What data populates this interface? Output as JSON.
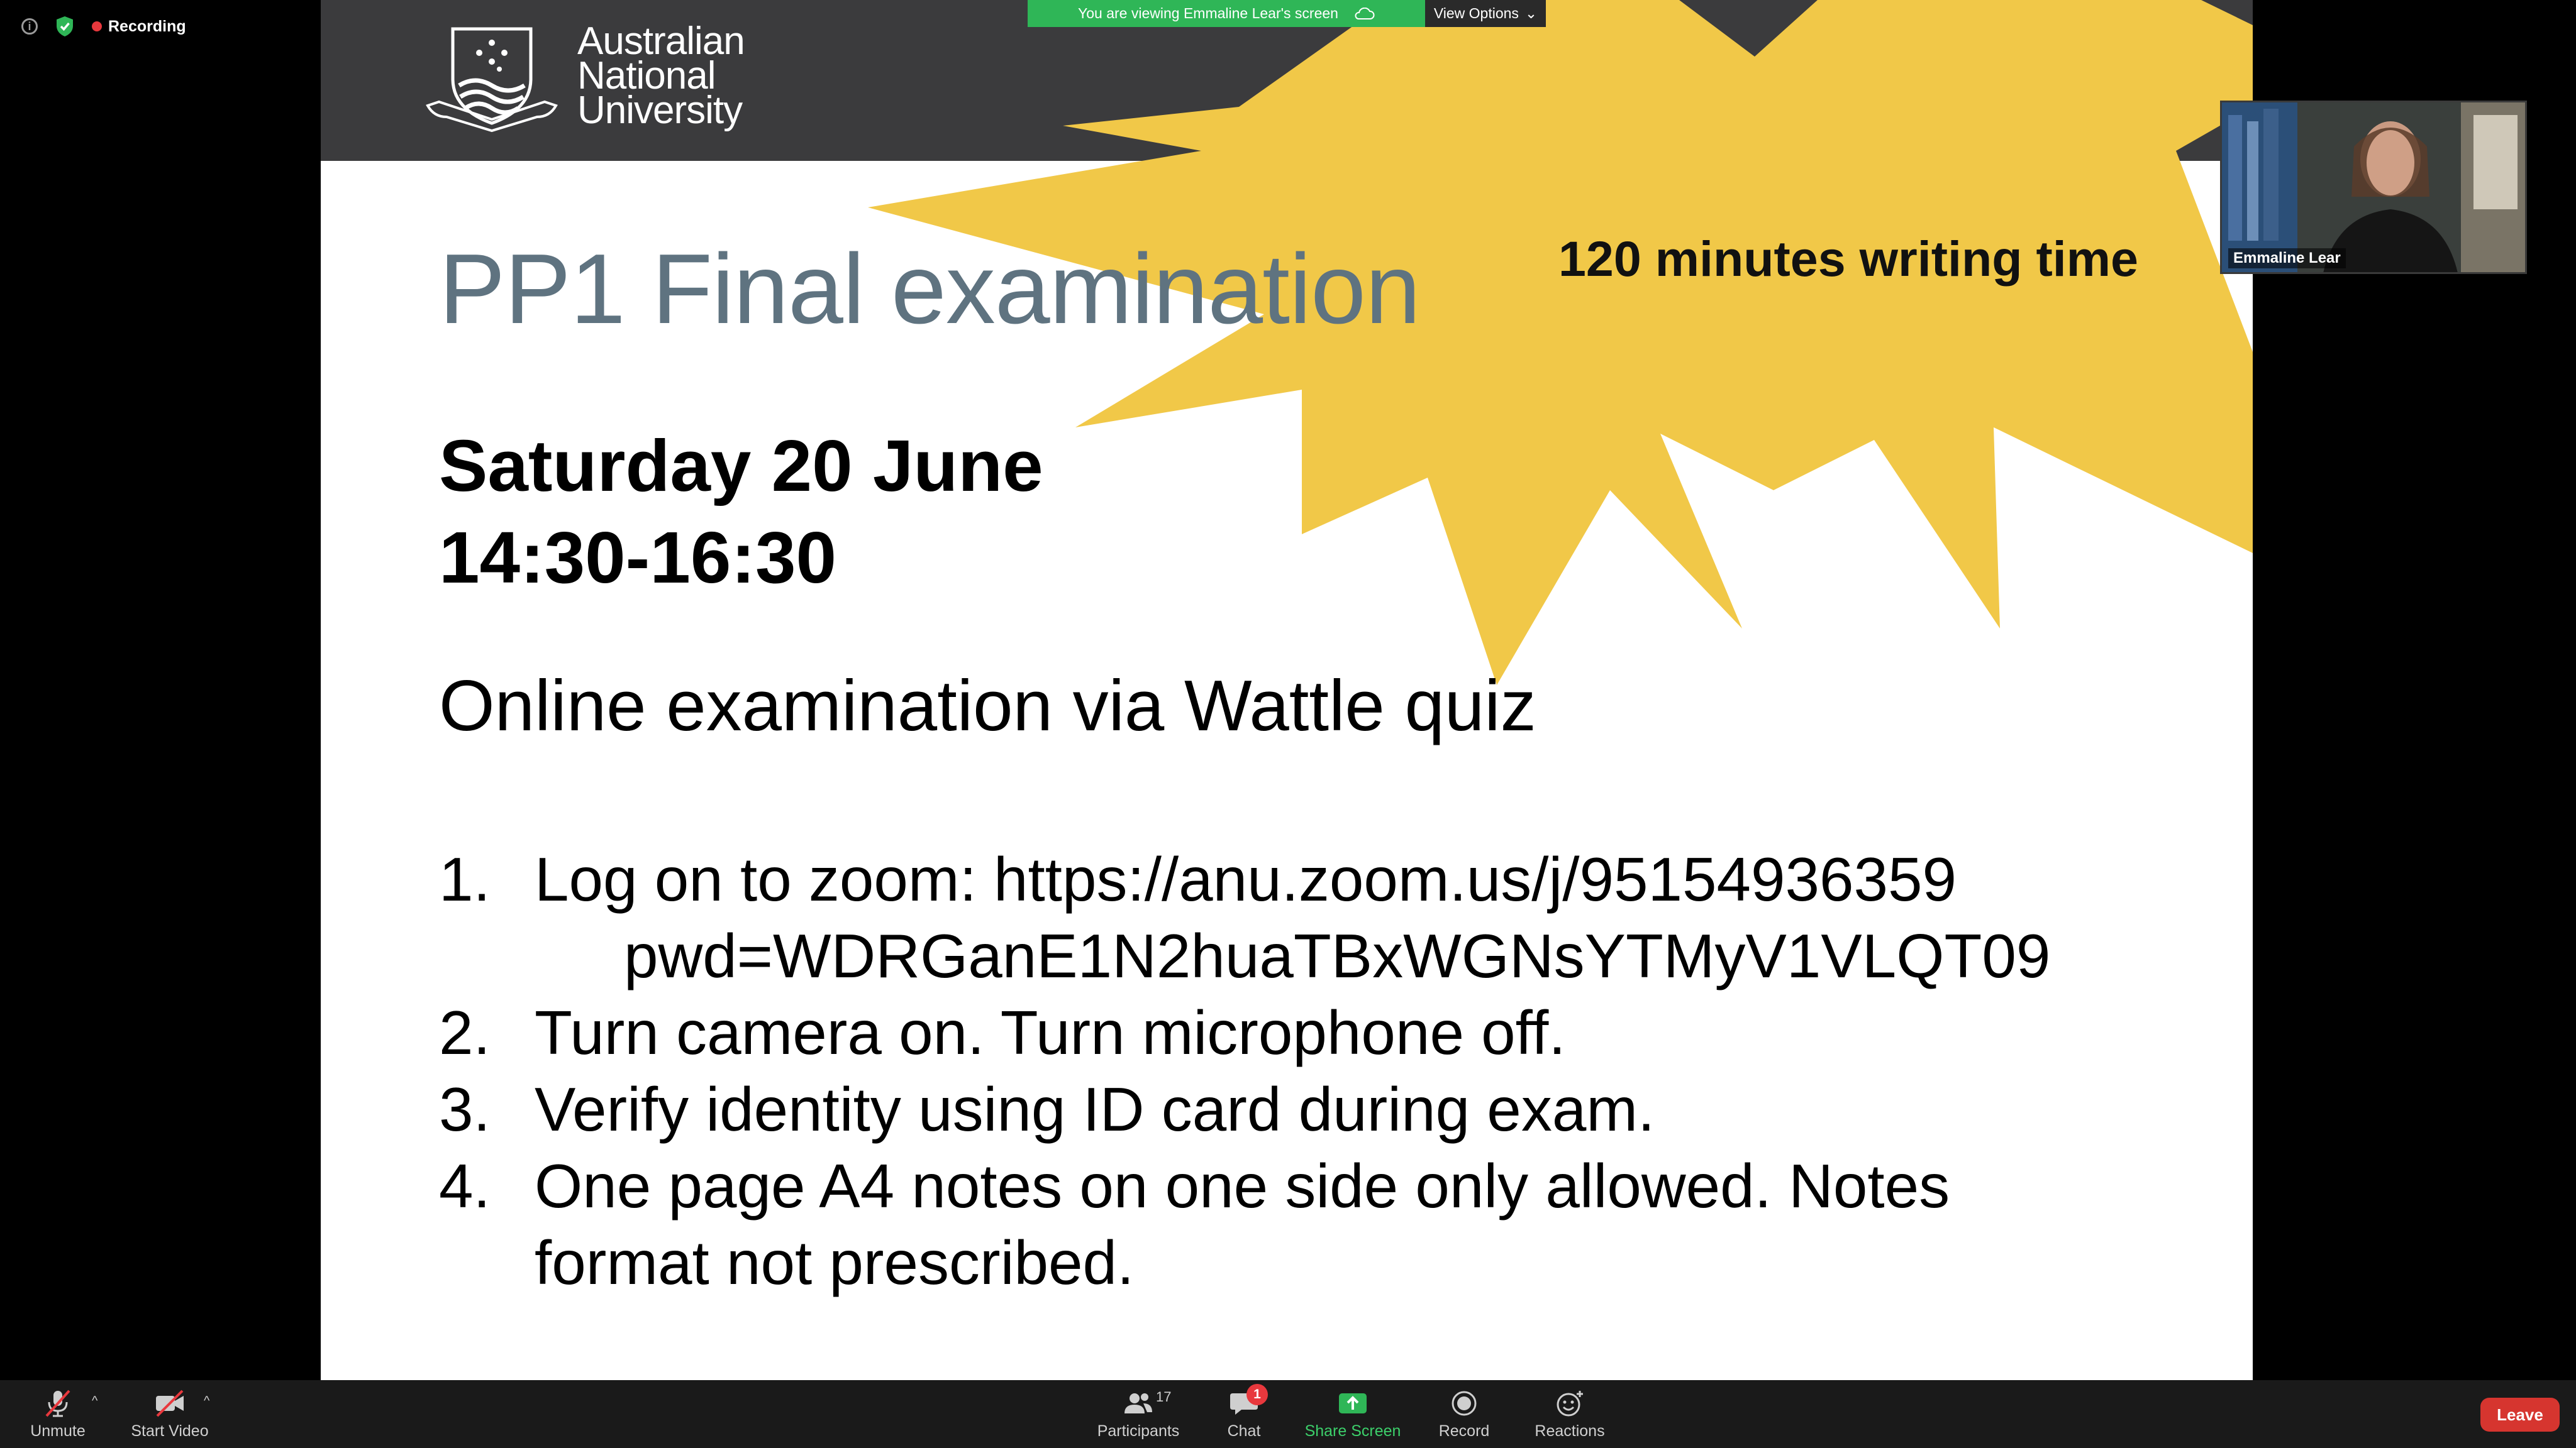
{
  "meeting": {
    "recording_label": "Recording"
  },
  "share_banner": {
    "text": "You are viewing Emmaline Lear's screen",
    "view_options_label": "View Options"
  },
  "slide": {
    "logo_lines": [
      "Australian",
      "National",
      "University"
    ],
    "starburst_text": "120 minutes writing time",
    "title": "PP1 Final examination",
    "date_line": "Saturday 20 June",
    "time_line": "14:30-16:30",
    "online_line": "Online examination via Wattle quiz",
    "steps": [
      {
        "num": "1.",
        "lines": [
          "Log on to zoom: https://anu.zoom.us/j/95154936359",
          "pwd=WDRGanE1N2huaTBxWGNsYTMyV1VLQT09"
        ]
      },
      {
        "num": "2.",
        "lines": [
          "Turn camera on. Turn microphone off."
        ]
      },
      {
        "num": "3.",
        "lines": [
          "Verify identity using ID card during exam."
        ]
      },
      {
        "num": "4.",
        "lines": [
          "One page A4 notes on one side only allowed. Notes",
          "format not prescribed."
        ]
      }
    ]
  },
  "video": {
    "participant_name": "Emmaline Lear"
  },
  "toolbar": {
    "unmute_label": "Unmute",
    "start_video_label": "Start Video",
    "participants_label": "Participants",
    "participants_count": "17",
    "chat_label": "Chat",
    "chat_badge": "1",
    "share_screen_label": "Share Screen",
    "record_label": "Record",
    "reactions_label": "Reactions",
    "leave_label": "Leave"
  },
  "colors": {
    "slide_header": "#3b3b3d",
    "starburst": "#f1c848",
    "title": "#5f7380",
    "share_green": "#2fb657",
    "leave_red": "#d6352f"
  }
}
